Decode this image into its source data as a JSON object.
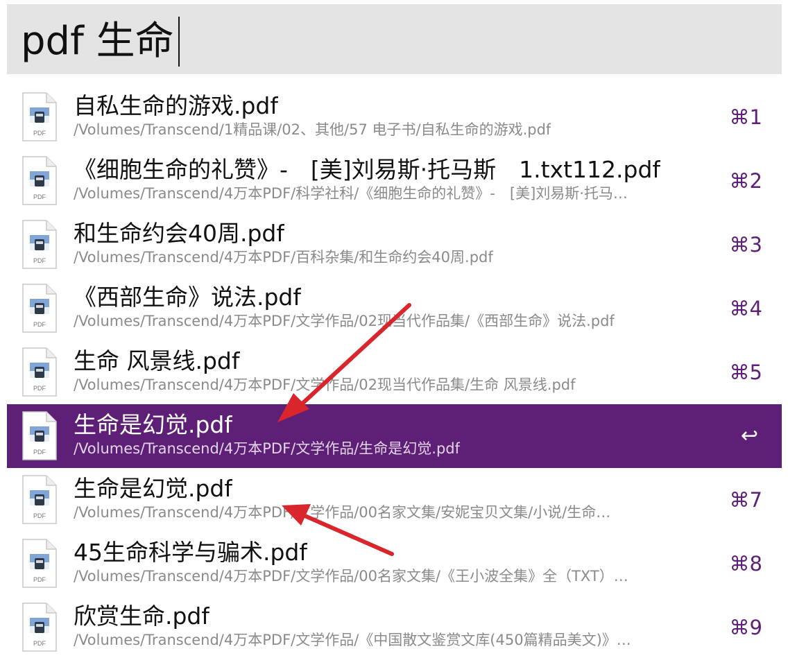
{
  "search": {
    "query": "pdf 生命"
  },
  "results": [
    {
      "title": "自私生命的游戏.pdf",
      "path": "/Volumes/Transcend/1精品课/02、其他/57 电子书/自私生命的游戏.pdf",
      "shortcut": "⌘1",
      "selected": false
    },
    {
      "title": "《细胞生命的礼赞》-　[美]刘易斯·托马斯　1.txt112.pdf",
      "path": "/Volumes/Transcend/4万本PDF/科学社科/《细胞生命的礼赞》-　[美]刘易斯·托马…",
      "shortcut": "⌘2",
      "selected": false
    },
    {
      "title": "和生命约会40周.pdf",
      "path": "/Volumes/Transcend/4万本PDF/百科杂集/和生命约会40周.pdf",
      "shortcut": "⌘3",
      "selected": false
    },
    {
      "title": "《西部生命》说法.pdf",
      "path": "/Volumes/Transcend/4万本PDF/文学作品/02现当代作品集/《西部生命》说法.pdf",
      "shortcut": "⌘4",
      "selected": false
    },
    {
      "title": "生命 风景线.pdf",
      "path": "/Volumes/Transcend/4万本PDF/文学作品/02现当代作品集/生命 风景线.pdf",
      "shortcut": "⌘5",
      "selected": false
    },
    {
      "title": "生命是幻觉.pdf",
      "path": "/Volumes/Transcend/4万本PDF/文学作品/生命是幻觉.pdf",
      "shortcut": "↩",
      "selected": true
    },
    {
      "title": "生命是幻觉.pdf",
      "path": "/Volumes/Transcend/4万本PDF/文学作品/00名家文集/安妮宝贝文集/小说/生命…",
      "shortcut": "⌘7",
      "selected": false
    },
    {
      "title": "45生命科学与骗术.pdf",
      "path": "/Volumes/Transcend/4万本PDF/文学作品/00名家文集/《王小波全集》全（TXT）…",
      "shortcut": "⌘8",
      "selected": false
    },
    {
      "title": "欣赏生命.pdf",
      "path": "/Volumes/Transcend/4万本PDF/文学作品/《中国散文鉴赏文库(450篇精品美文)》…",
      "shortcut": "⌘9",
      "selected": false
    }
  ],
  "icons": {
    "file_icon": "pdf-file-icon",
    "file_icon_label": "PDF",
    "annotation": "red-arrow-annotation"
  },
  "colors": {
    "accent": "#5e2076",
    "search_bg": "#e4e4e4",
    "annotation": "#d9262c"
  }
}
